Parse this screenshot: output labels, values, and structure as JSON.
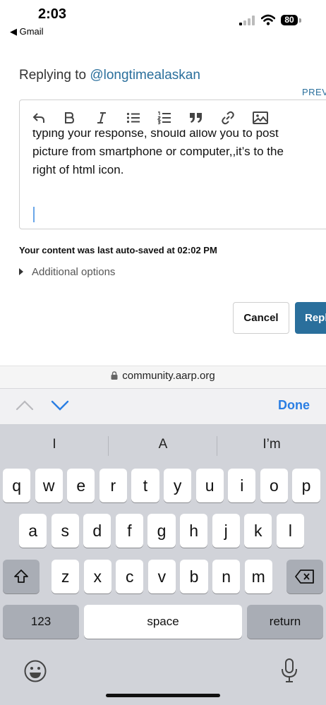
{
  "status": {
    "time": "2:03",
    "back_app": "◀ Gmail",
    "battery": "80"
  },
  "reply": {
    "label": "Replying to ",
    "user": "@longtimealaskan",
    "preview": "PREV"
  },
  "toolbar": {
    "items": [
      "undo-icon",
      "bold-icon",
      "italic-icon",
      "bullet-list-icon",
      "numbered-list-icon",
      "quote-icon",
      "link-icon",
      "image-icon"
    ]
  },
  "editor": {
    "line_clipped": "typing your response, should allow you to post",
    "line2": "picture from smartphone or computer,,it’s to the",
    "line3": "right of html icon."
  },
  "autosave": "Your content was last auto-saved at 02:02 PM",
  "additional_options": "Additional options",
  "buttons": {
    "cancel": "Cancel",
    "reply": "Repl"
  },
  "browser": {
    "url": "community.aarp.org",
    "done": "Done"
  },
  "keyboard": {
    "suggestions": [
      "I",
      "A",
      "I’m"
    ],
    "row1": [
      "q",
      "w",
      "e",
      "r",
      "t",
      "y",
      "u",
      "i",
      "o",
      "p"
    ],
    "row2": [
      "a",
      "s",
      "d",
      "f",
      "g",
      "h",
      "j",
      "k",
      "l"
    ],
    "row3": [
      "z",
      "x",
      "c",
      "v",
      "b",
      "n",
      "m"
    ],
    "numbers": "123",
    "space": "space",
    "return": "return"
  },
  "colors": {
    "accent": "#2a6f9c",
    "ios_blue": "#2a7ee3",
    "keyboard_bg": "#d1d3d9"
  }
}
